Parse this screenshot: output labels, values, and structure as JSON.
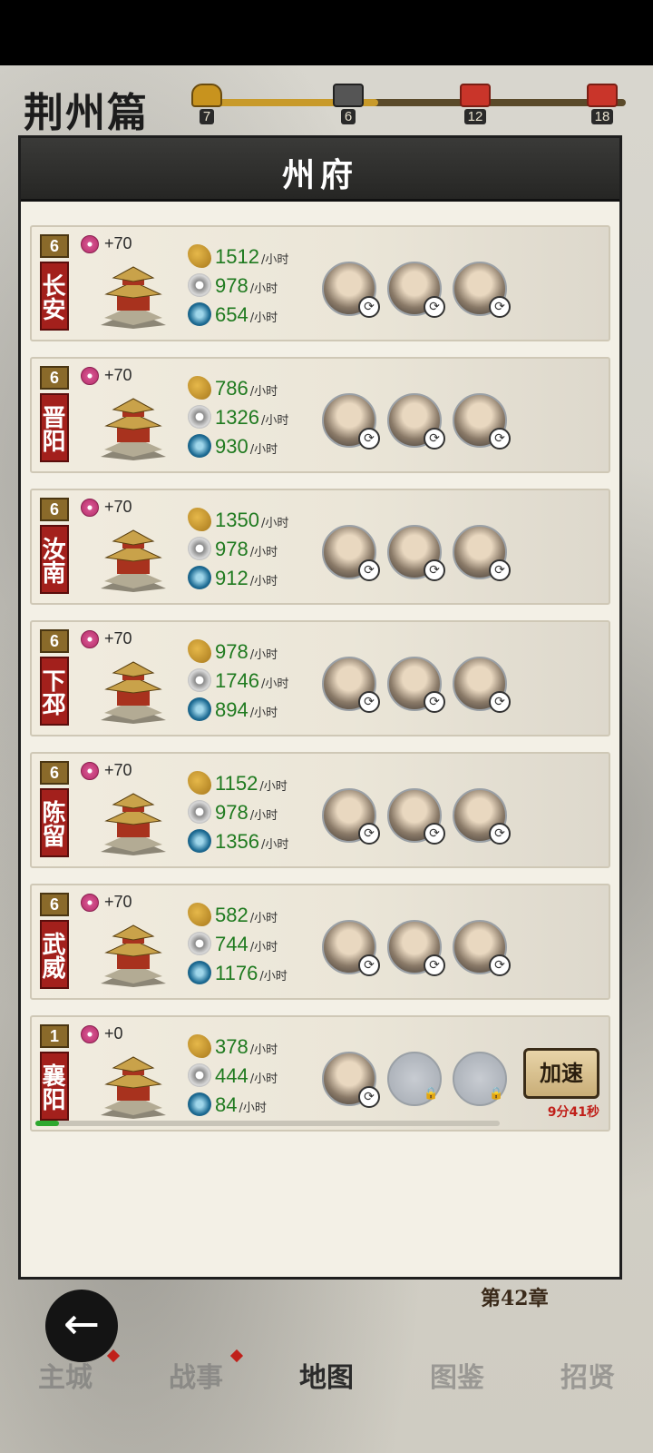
{
  "header": {
    "chapter_title": "荆州篇",
    "milestones": [
      {
        "value": "7",
        "type": "red"
      },
      {
        "value": "6",
        "type": "gray"
      },
      {
        "value": "12",
        "type": "red"
      },
      {
        "value": "18",
        "type": "red"
      }
    ],
    "progress": 0.42
  },
  "panel": {
    "title": "州府",
    "rate_unit": "/小时",
    "cities": [
      {
        "level": "6",
        "name": "长安",
        "bonus": "+70",
        "grain": "1512",
        "coin": "978",
        "jade": "654",
        "heroes": 3,
        "locked": 0
      },
      {
        "level": "6",
        "name": "晋阳",
        "bonus": "+70",
        "grain": "786",
        "coin": "1326",
        "jade": "930",
        "heroes": 3,
        "locked": 0
      },
      {
        "level": "6",
        "name": "汝南",
        "bonus": "+70",
        "grain": "1350",
        "coin": "978",
        "jade": "912",
        "heroes": 3,
        "locked": 0
      },
      {
        "level": "6",
        "name": "下邳",
        "bonus": "+70",
        "grain": "978",
        "coin": "1746",
        "jade": "894",
        "heroes": 3,
        "locked": 0
      },
      {
        "level": "6",
        "name": "陈留",
        "bonus": "+70",
        "grain": "1152",
        "coin": "978",
        "jade": "1356",
        "heroes": 3,
        "locked": 0
      },
      {
        "level": "6",
        "name": "武威",
        "bonus": "+70",
        "grain": "582",
        "coin": "744",
        "jade": "1176",
        "heroes": 3,
        "locked": 0
      },
      {
        "level": "1",
        "name": "襄阳",
        "bonus": "+0",
        "grain": "378",
        "coin": "444",
        "jade": "84",
        "heroes": 1,
        "locked": 2,
        "speed_label": "加速",
        "timer": "9分41秒",
        "build_progress": 0.05
      }
    ]
  },
  "footer": {
    "chapter_tag": "第42章",
    "nav": [
      "主城",
      "战事",
      "地图",
      "图鉴",
      "招贤"
    ],
    "active_index": 2
  }
}
